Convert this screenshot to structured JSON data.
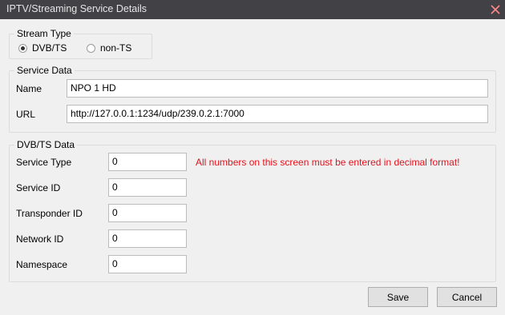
{
  "window": {
    "title": "IPTV/Streaming Service Details",
    "close_icon": "close-icon"
  },
  "stream_type": {
    "legend": "Stream Type",
    "options": [
      {
        "label": "DVB/TS",
        "selected": true
      },
      {
        "label": "non-TS",
        "selected": false
      }
    ]
  },
  "service_data": {
    "legend": "Service Data",
    "name_label": "Name",
    "name_value": "NPO 1 HD",
    "url_label": "URL",
    "url_value": "http://127.0.0.1:1234/udp/239.0.2.1:7000"
  },
  "dvb_ts": {
    "legend": "DVB/TS Data",
    "warning": "All numbers on this screen must be entered in decimal format!",
    "fields": [
      {
        "label": "Service Type",
        "value": "0"
      },
      {
        "label": "Service ID",
        "value": "0"
      },
      {
        "label": "Transponder ID",
        "value": "0"
      },
      {
        "label": "Network ID",
        "value": "0"
      },
      {
        "label": "Namespace",
        "value": "0"
      }
    ]
  },
  "buttons": {
    "save": "Save",
    "cancel": "Cancel"
  },
  "colors": {
    "titlebar": "#414146",
    "warning": "#e0141e",
    "close_icon": "#ff8a8a"
  }
}
